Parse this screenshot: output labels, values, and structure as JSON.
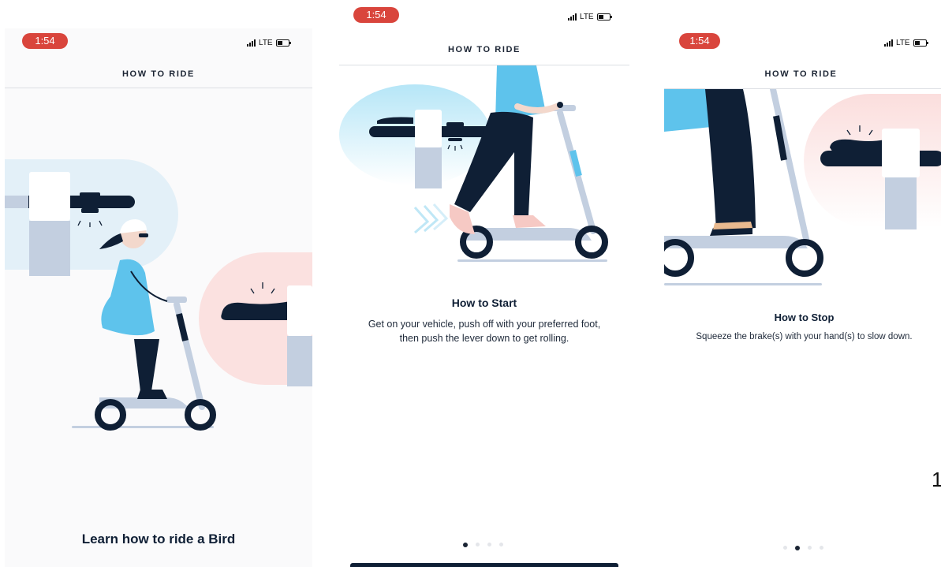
{
  "status_bar": {
    "time": "1:54",
    "network": "LTE"
  },
  "nav": {
    "title": "HOW TO RIDE"
  },
  "screens": [
    {
      "heading": "Learn how to ride a Bird"
    },
    {
      "heading": "How to Start",
      "body_line1": "Get on your vehicle, push off with your preferred foot,",
      "body_line2": "then push the lever down to get rolling.",
      "active_page": 1,
      "page_count": 4
    },
    {
      "heading": "How to Stop",
      "body": "Squeeze the brake(s) with your hand(s) to slow down.",
      "active_page": 2,
      "page_count": 4
    }
  ],
  "page_number": "1",
  "colors": {
    "time_pill": "#d9453c",
    "navy": "#0f1f35",
    "sky_blue": "#5ec3ec",
    "scooter_gray": "#c3cfe0",
    "pink_bg": "#fbe1e0",
    "blue_bg": "#dff1fb"
  },
  "icons": [
    "signal-icon",
    "battery-icon",
    "scooter-illustration",
    "throttle-lever-illustration",
    "brake-lever-illustration"
  ]
}
